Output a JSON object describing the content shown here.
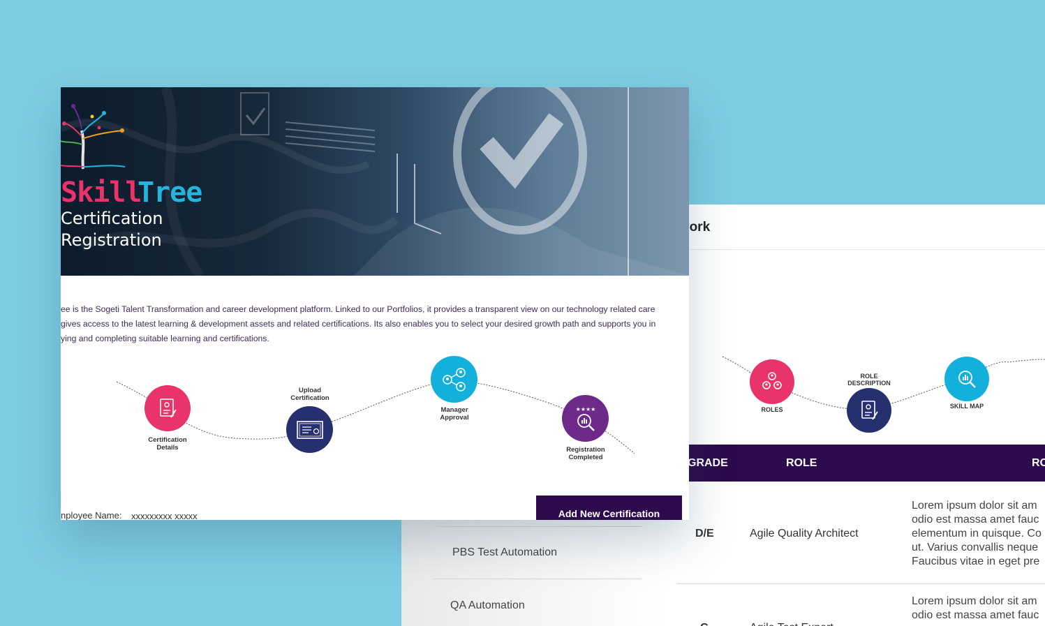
{
  "front": {
    "brand": {
      "skill": "Skill",
      "tree": "Tree"
    },
    "banner": {
      "line1": "Certification",
      "line2": "Registration"
    },
    "description": [
      "ee is the Sogeti Talent Transformation and career development platform. Linked to our Portfolios, it provides a transparent view on our technology related care",
      "gives access to the latest learning & development assets and related certifications. Its also enables you to select your desired growth path and supports you in",
      "ying and completing suitable learning and certifications."
    ],
    "steps": [
      {
        "label": "Certification\nDetails",
        "icon": "certificate-edit-icon",
        "color": "#e8336b"
      },
      {
        "label": "Upload\nCertification",
        "icon": "certificate-upload-icon",
        "color": "#27306e"
      },
      {
        "label": "Manager\nApproval",
        "icon": "network-users-icon",
        "color": "#13b0dc"
      },
      {
        "label": "Registration\nCompleted",
        "icon": "analytics-search-icon",
        "color": "#6d2a8a"
      }
    ],
    "employee": {
      "label": "nployee Name:",
      "value": "xxxxxxxxx xxxxx"
    },
    "add_button": "Add New Certification"
  },
  "back": {
    "title": "vork",
    "steps": [
      {
        "label": "ROLES",
        "icon": "roles-users-icon",
        "color": "#e8336b"
      },
      {
        "label": "ROLE\nDESCRIPTION",
        "icon": "role-document-icon",
        "color": "#27306e"
      },
      {
        "label": "SKILL MAP",
        "icon": "skill-map-search-icon",
        "color": "#13b0dc"
      }
    ],
    "table": {
      "headers": [
        "GRADE",
        "ROLE",
        "RO"
      ],
      "rows": [
        {
          "grade": "D/E",
          "role": "Agile Quality Architect",
          "desc": [
            "Lorem ipsum dolor sit am",
            "odio est massa amet fauc",
            "elementum in quisque. Co",
            "ut. Varius convallis neque",
            "Faucibus vitae in eget pre"
          ]
        },
        {
          "grade": "C",
          "role": "Agile Test Expert",
          "desc": [
            "Lorem ipsum dolor sit am",
            "odio est massa amet fauc"
          ]
        }
      ]
    },
    "list": [
      "PBS Test Automation",
      "QA Automation"
    ]
  }
}
